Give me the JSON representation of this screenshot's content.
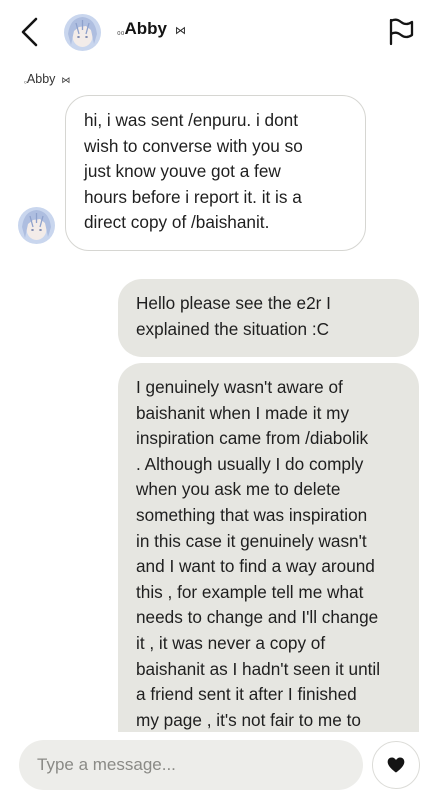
{
  "header": {
    "name_prefix": "₀₀",
    "name": "Abby",
    "name_suffix": "⋈",
    "back_icon": "chevron-left-icon",
    "report_icon": "flag-icon"
  },
  "thread": {
    "sender_label_prefix": "₀",
    "sender_label": "Abby",
    "sender_label_suffix": "⋈"
  },
  "messages": [
    {
      "direction": "incoming",
      "text": "hi, i was sent /enpuru. i dont\nwish to converse with you so\njust know youve got a few\nhours before i report it. it is a\ndirect copy of /baishanit."
    },
    {
      "direction": "outgoing",
      "text": "Hello please see the e2r I\nexplained the situation :C"
    },
    {
      "direction": "outgoing",
      "text": "I genuinely wasn't aware of\nbaishanit when I made it my\ninspiration came from /diabolik\n. Although usually I do comply\nwhen you ask me to delete\nsomething that was inspiration\nin this case it genuinely wasn't\nand I want to find a way around\nthis , for example tell me what\nneeds to change and I'll change\nit , it was never a copy of\nbaishanit as I hadn't seen it until\na friend sent it after I finished\nmy page , it's not fair to me to"
    }
  ],
  "composer": {
    "placeholder": "Type a message...",
    "heart_icon": "heart-icon"
  },
  "colors": {
    "outgoing_bubble": "#e6e6e1",
    "incoming_border": "#d6d6d2",
    "input_bg": "#ededea",
    "text": "#1f1f1f"
  }
}
